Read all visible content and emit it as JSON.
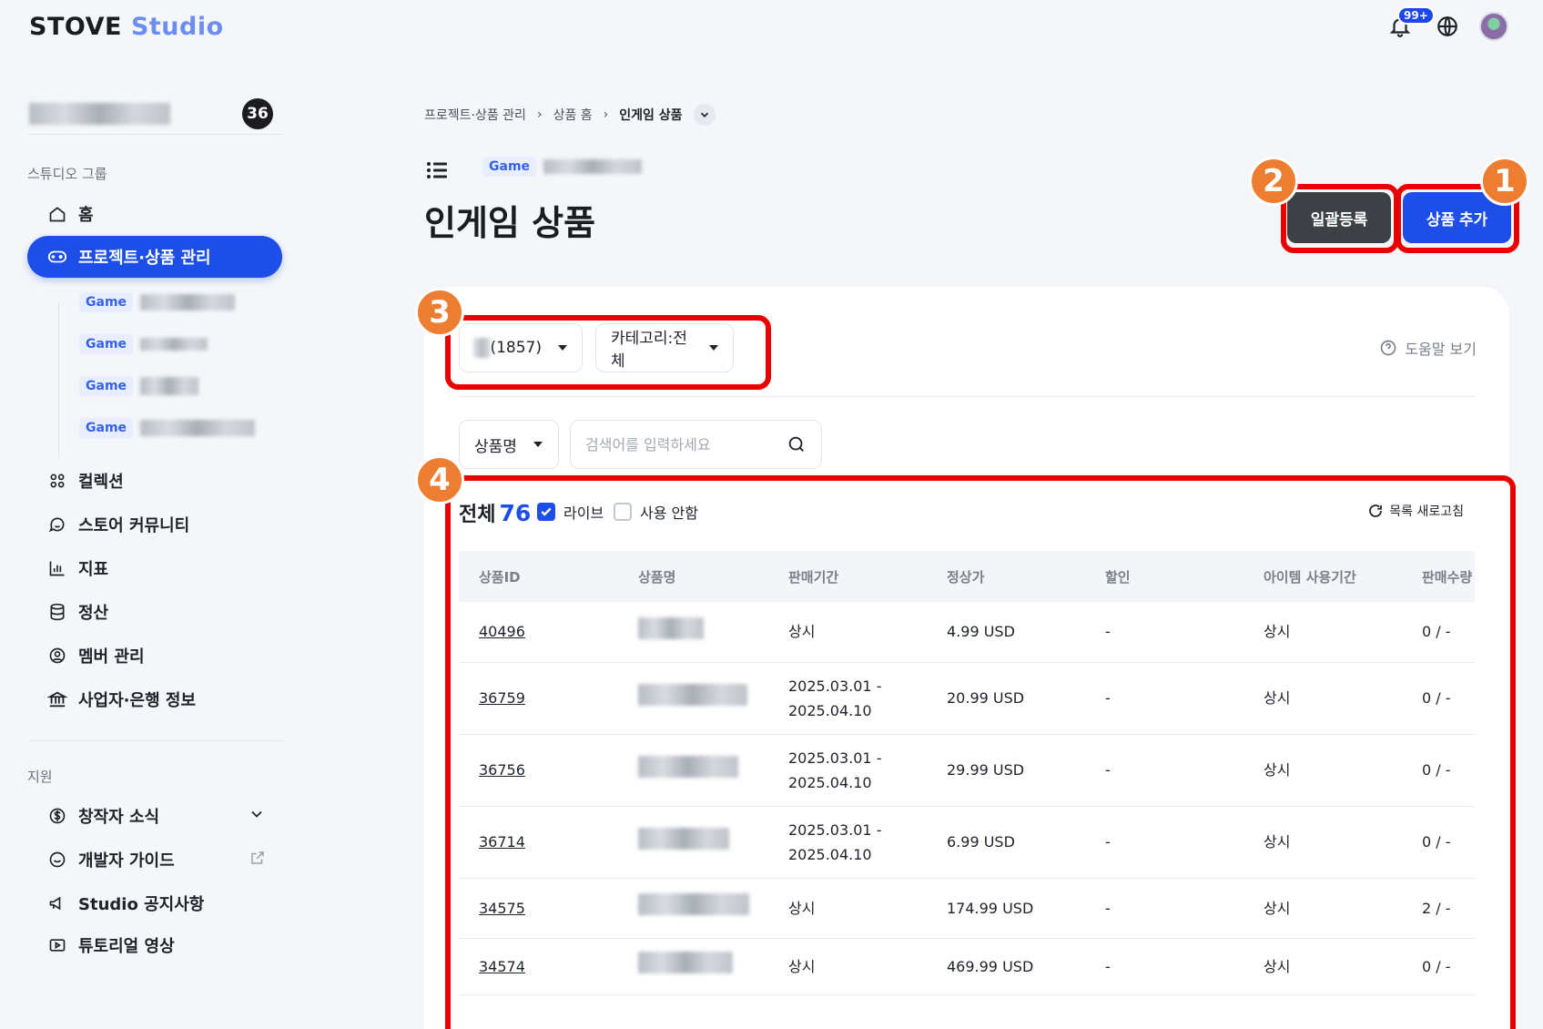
{
  "logo": {
    "part1": "STOVE",
    "part2": "Studio"
  },
  "topbar": {
    "bell_badge": "99+",
    "icons": [
      "bell-icon",
      "globe-icon",
      "avatar"
    ]
  },
  "sidebar": {
    "studio_count": "36",
    "group_label": "스튜디오 그룹",
    "items": [
      {
        "label": "홈",
        "icon": "home-icon"
      },
      {
        "label": "프로젝트·상품 관리",
        "icon": "gamepad-icon",
        "active": true
      },
      {
        "label": "컬렉션",
        "icon": "grid-icon"
      },
      {
        "label": "스토어 커뮤니티",
        "icon": "chat-icon"
      },
      {
        "label": "지표",
        "icon": "chart-icon"
      },
      {
        "label": "정산",
        "icon": "database-icon"
      },
      {
        "label": "멤버 관리",
        "icon": "user-circle-icon"
      },
      {
        "label": "사업자·은행 정보",
        "icon": "bank-icon"
      }
    ],
    "game_chip": "Game",
    "support_label": "지원",
    "support_items": [
      {
        "label": "창작자 소식",
        "icon": "dollar-icon"
      },
      {
        "label": "개발자 가이드",
        "icon": "smile-icon"
      },
      {
        "label": "Studio 공지사항",
        "icon": "megaphone-icon"
      },
      {
        "label": "튜토리얼 영상",
        "icon": "video-icon"
      }
    ]
  },
  "breadcrumb": {
    "item1": "프로젝트·상품 관리",
    "item2": "상품 홈",
    "current": "인게임 상품"
  },
  "header": {
    "game_chip": "Game",
    "title": "인게임 상품",
    "bulk_button": "일괄등록",
    "add_button": "상품 추가"
  },
  "filters": {
    "server_count": "(1857)",
    "category": "카테고리:전체",
    "help": "도움말 보기",
    "search_type": "상품명",
    "search_placeholder": "검색어를 입력하세요"
  },
  "list": {
    "total_label": "전체",
    "total_count": "76",
    "live_label": "라이브",
    "unused_label": "사용 안함",
    "refresh_label": "목록 새로고침"
  },
  "table": {
    "headers": [
      "상품ID",
      "상품명",
      "판매기간",
      "정상가",
      "할인",
      "아이템 사용기간",
      "판매수량"
    ],
    "rows": [
      {
        "id": "40496",
        "period1": "상시",
        "period2": "",
        "price": "4.99 USD",
        "discount": "-",
        "use": "상시",
        "sold": "0 / -"
      },
      {
        "id": "36759",
        "period1": "2025.03.01 -",
        "period2": "2025.04.10",
        "price": "20.99 USD",
        "discount": "-",
        "use": "상시",
        "sold": "0 / -"
      },
      {
        "id": "36756",
        "period1": "2025.03.01 -",
        "period2": "2025.04.10",
        "price": "29.99 USD",
        "discount": "-",
        "use": "상시",
        "sold": "0 / -"
      },
      {
        "id": "36714",
        "period1": "2025.03.01 -",
        "period2": "2025.04.10",
        "price": "6.99 USD",
        "discount": "-",
        "use": "상시",
        "sold": "0 / -"
      },
      {
        "id": "34575",
        "period1": "상시",
        "period2": "",
        "price": "174.99 USD",
        "discount": "-",
        "use": "상시",
        "sold": "2 / -"
      },
      {
        "id": "34574",
        "period1": "상시",
        "period2": "",
        "price": "469.99 USD",
        "discount": "-",
        "use": "상시",
        "sold": "0 / -"
      }
    ]
  },
  "markers": [
    "1",
    "2",
    "3",
    "4"
  ],
  "colors": {
    "primary": "#1d4fe8",
    "annotation": "#ea0000",
    "marker": "#ed7d31"
  }
}
